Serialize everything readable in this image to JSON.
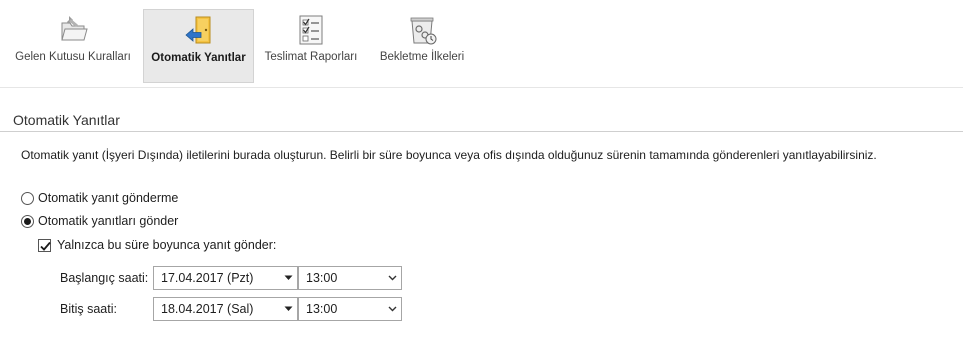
{
  "toolbar": {
    "items": [
      {
        "label": "Gelen Kutusu Kuralları",
        "icon": "folder-rules-icon"
      },
      {
        "label": "Otomatik Yanıtlar",
        "icon": "door-arrow-icon"
      },
      {
        "label": "Teslimat Raporları",
        "icon": "checklist-icon"
      },
      {
        "label": "Bekletme İlkeleri",
        "icon": "retention-bin-icon"
      }
    ],
    "active": "Otomatik Yanıtlar"
  },
  "section": {
    "title": "Otomatik Yanıtlar",
    "description": "Otomatik yanıt (İşyeri Dışında) iletilerini burada oluşturun. Belirli bir süre boyunca veya ofis dışında olduğunuz sürenin tamamında gönderenleri yanıtlayabilirsiniz."
  },
  "options": {
    "dont_send": {
      "label": "Otomatik yanıt gönderme",
      "selected": false
    },
    "send": {
      "label": "Otomatik yanıtları gönder",
      "selected": true
    }
  },
  "time_period": {
    "label": "Yalnızca bu süre boyunca yanıt gönder:",
    "checked": true,
    "start": {
      "label": "Başlangıç saati:",
      "date": "17.04.2017 (Pzt)",
      "time": "13:00"
    },
    "end": {
      "label": "Bitiş saati:",
      "date": "18.04.2017 (Sal)",
      "time": "13:00"
    }
  },
  "colors": {
    "active_tab_bg": "#e9e9e9",
    "border": "#a6a6a6",
    "rule": "#cfcfcf"
  }
}
